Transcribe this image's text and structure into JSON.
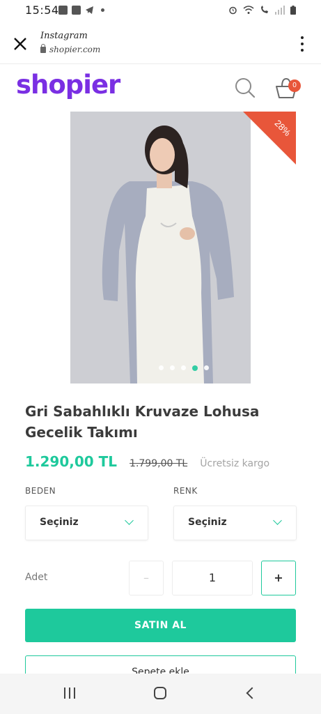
{
  "status_bar": {
    "time": "15:54"
  },
  "browser": {
    "title": "Instagram",
    "url": "shopier.com"
  },
  "shop": {
    "logo": "shopier",
    "cart_count": "0"
  },
  "product": {
    "discount": "28%",
    "title": "Gri Sabahlıklı Kruvaze Lohusa Gecelik Takımı",
    "price": "1.290,00 TL",
    "old_price": "1.799,00 TL",
    "shipping": "Ücretsiz kargo",
    "gallery": {
      "total_images": 5,
      "active_index": 3
    }
  },
  "options": {
    "size": {
      "label": "BEDEN",
      "value": "Seçiniz"
    },
    "color": {
      "label": "RENK",
      "value": "Seçiniz"
    }
  },
  "quantity": {
    "label": "Adet",
    "value": "1",
    "minus": "–",
    "plus": "+"
  },
  "actions": {
    "buy": "SATIN AL",
    "add_to_cart": "Sepete ekle"
  },
  "colors": {
    "brand": "#7a2fe3",
    "accent": "#1ec99c",
    "badge": "#e8563a"
  }
}
